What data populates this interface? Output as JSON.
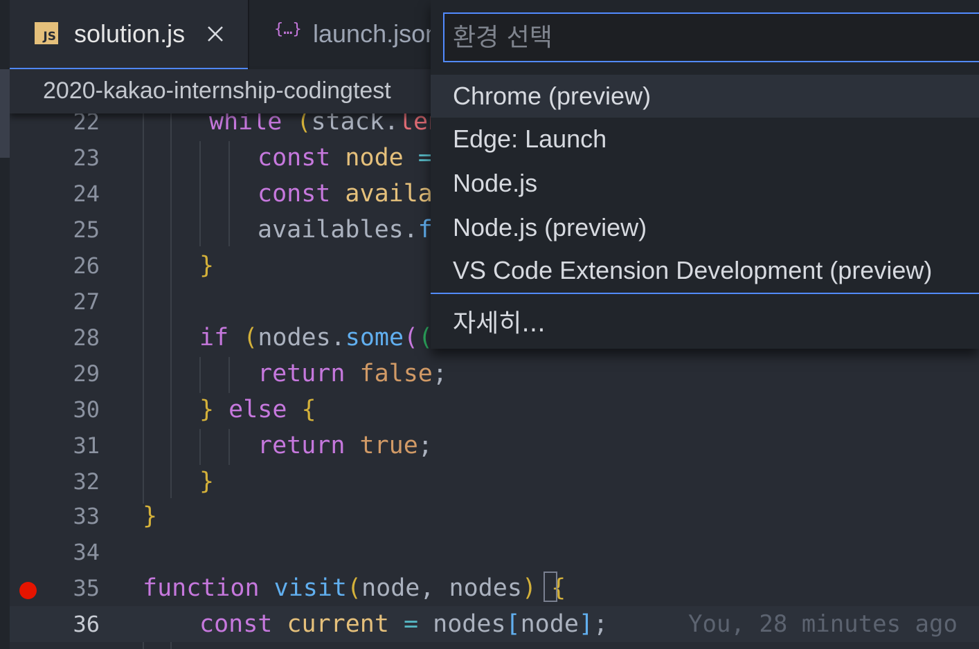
{
  "tabs": [
    {
      "label": "solution.js",
      "icon": "javascript-file-icon",
      "active": true
    },
    {
      "label": "launch.json",
      "icon": "json-braces-icon",
      "active": false
    }
  ],
  "breadcrumb": {
    "path": "2020-kakao-internship-codingtest"
  },
  "quickpick": {
    "placeholder": "환경 선택",
    "items": [
      {
        "label": "Chrome (preview)",
        "selected": true
      },
      {
        "label": "Edge: Launch"
      },
      {
        "label": "Node.js"
      },
      {
        "label": "Node.js (preview)"
      },
      {
        "label": "VS Code Extension Development (preview)"
      }
    ],
    "more_label": "자세히..."
  },
  "editor": {
    "breakpoint_line": 35,
    "current_line": 36,
    "blame": "You, 28 minutes ago",
    "lines": [
      {
        "number": "22"
      },
      {
        "number": "23"
      },
      {
        "number": "24"
      },
      {
        "number": "25"
      },
      {
        "number": "26"
      },
      {
        "number": "27"
      },
      {
        "number": "28"
      },
      {
        "number": "29"
      },
      {
        "number": "30"
      },
      {
        "number": "31"
      },
      {
        "number": "32"
      },
      {
        "number": "33"
      },
      {
        "number": "34"
      },
      {
        "number": "35"
      },
      {
        "number": "36"
      }
    ],
    "tokens": {
      "l22": [
        "while",
        " (",
        "stack",
        ".",
        "len"
      ],
      "l23": [
        "const",
        " node",
        " ="
      ],
      "l24": [
        "const",
        " availa"
      ],
      "l25": [
        "availables",
        ".",
        "f"
      ],
      "l26": [
        "}"
      ],
      "l28": [
        "if",
        " (",
        "nodes",
        ".",
        "some",
        "(",
        "("
      ],
      "l29": [
        "return",
        " false",
        ";"
      ],
      "l30": [
        "}",
        " else",
        " {"
      ],
      "l31": [
        "return",
        " true",
        ";"
      ],
      "l32": [
        "}"
      ],
      "l33": [
        "}"
      ],
      "l35": [
        "function",
        " visit",
        "(",
        "node",
        ",",
        " nodes",
        ")",
        " ",
        "{"
      ],
      "l36": [
        "const",
        " current",
        " =",
        " nodes",
        "[",
        "node",
        "]",
        ";"
      ]
    }
  },
  "colors": {
    "accent": "#528bff",
    "breakpoint": "#e51400",
    "keyword": "#c678dd",
    "function": "#61afef",
    "variable": "#e5c07b"
  }
}
